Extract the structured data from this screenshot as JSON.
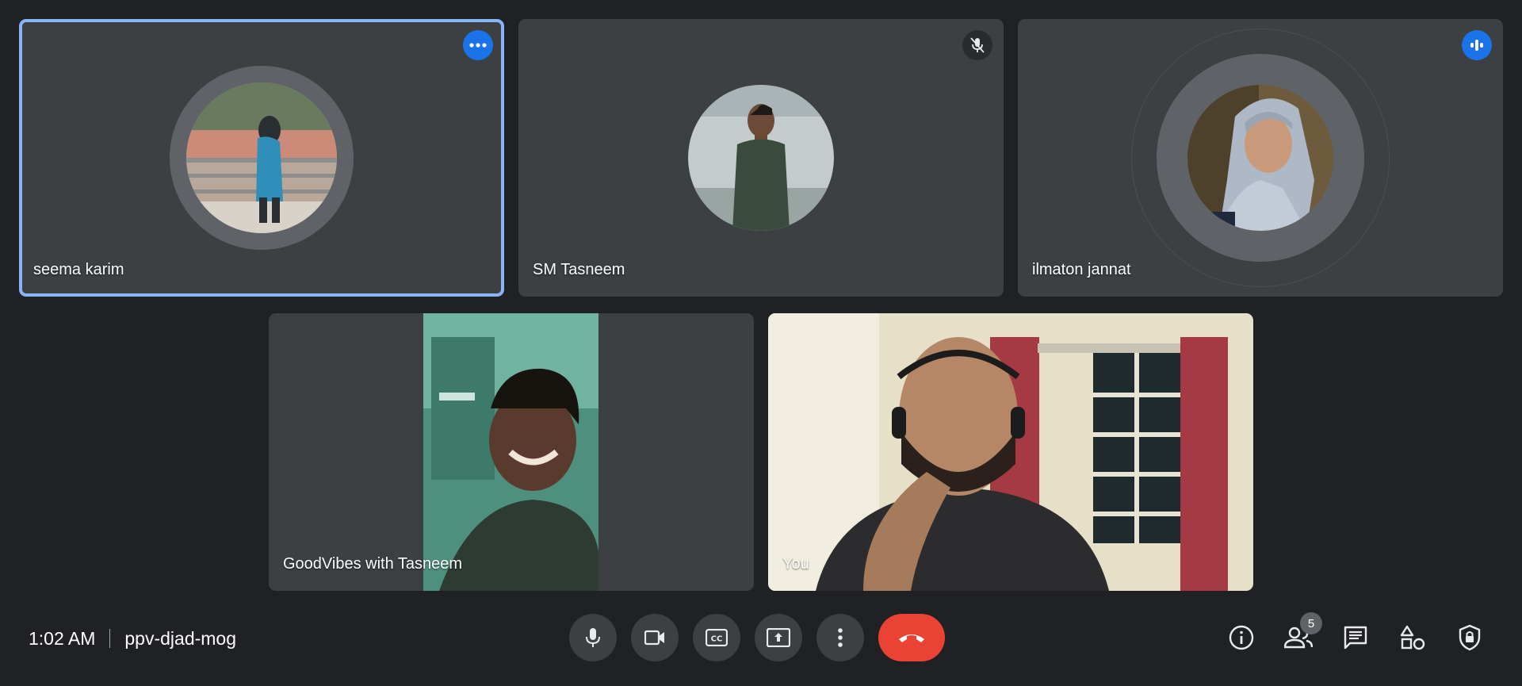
{
  "participants": [
    {
      "name": "seema karim",
      "state": "avatar",
      "badge": "more-options-icon",
      "active": true
    },
    {
      "name": "SM Tasneem",
      "state": "avatar",
      "badge": "mic-off-icon"
    },
    {
      "name": "ilmaton jannat",
      "state": "avatar",
      "badge": "speaking-icon"
    },
    {
      "name": "GoodVibes with Tasneem",
      "state": "video"
    },
    {
      "name": "You",
      "state": "video"
    }
  ],
  "meeting": {
    "time": "1:02 AM",
    "code": "ppv-djad-mog"
  },
  "controls": [
    {
      "icon": "microphone-icon"
    },
    {
      "icon": "camera-icon"
    },
    {
      "icon": "closed-captions-icon"
    },
    {
      "icon": "present-screen-icon"
    },
    {
      "icon": "more-vert-icon"
    },
    {
      "icon": "end-call-icon"
    }
  ],
  "right_panel": [
    {
      "icon": "info-icon"
    },
    {
      "icon": "people-icon",
      "count": "5"
    },
    {
      "icon": "chat-icon"
    },
    {
      "icon": "activities-icon"
    },
    {
      "icon": "host-controls-icon"
    }
  ],
  "colors": {
    "background": "#202124",
    "tile": "#3c4043",
    "accent": "#1a73e8",
    "active_outline": "#8ab4f8",
    "end_call": "#ea4335"
  }
}
